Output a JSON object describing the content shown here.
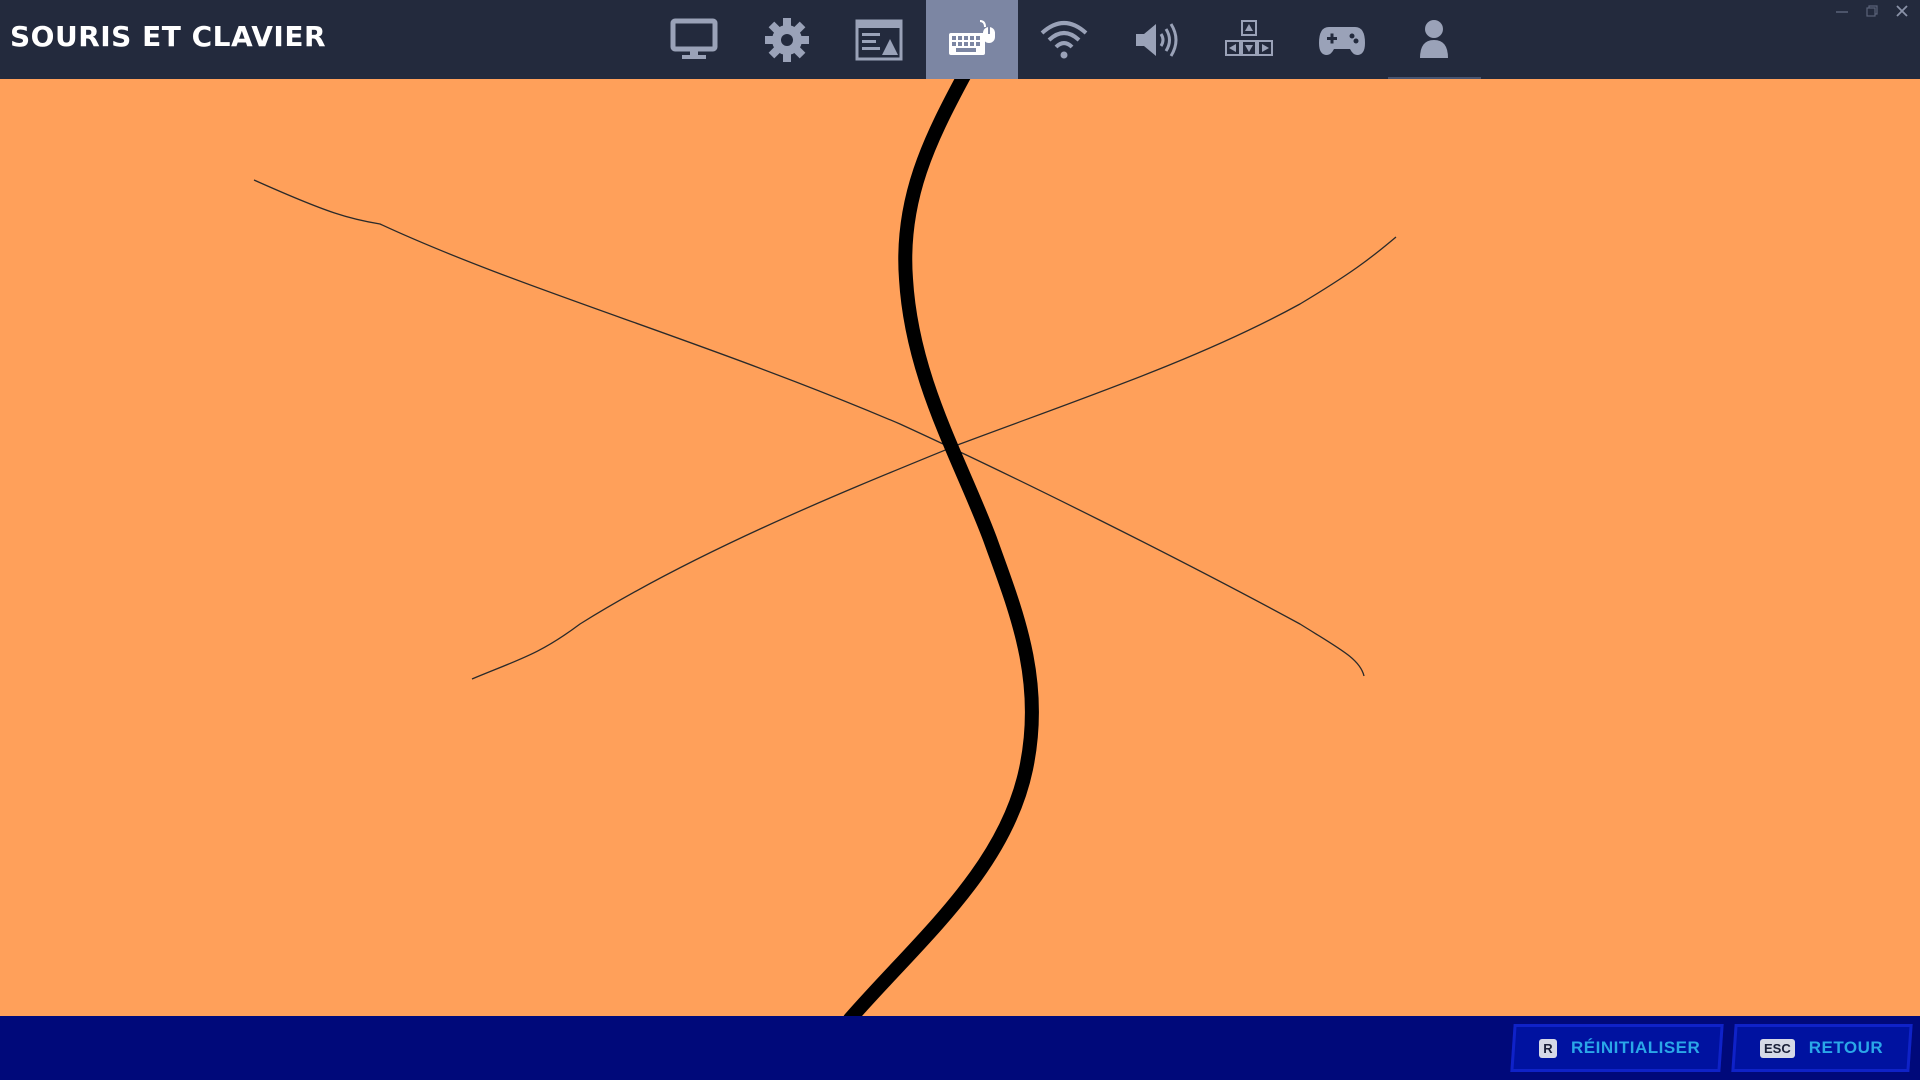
{
  "header": {
    "title": "SOURIS ET CLAVIER",
    "tabs": [
      {
        "icon": "monitor-icon",
        "active": false
      },
      {
        "icon": "gear-icon",
        "active": false
      },
      {
        "icon": "interface-icon",
        "active": false
      },
      {
        "icon": "keyboard-mouse-icon",
        "active": true
      },
      {
        "icon": "wifi-icon",
        "active": false
      },
      {
        "icon": "speaker-icon",
        "active": false
      },
      {
        "icon": "accessibility-arrows-icon",
        "active": false
      },
      {
        "icon": "gamepad-icon",
        "active": false
      },
      {
        "icon": "account-icon",
        "active": false
      }
    ]
  },
  "window_controls": [
    "minimize-icon",
    "restore-icon",
    "close-icon"
  ],
  "footer": {
    "reset": {
      "key": "R",
      "label": "RÉINITIALISER"
    },
    "back": {
      "key": "ESC",
      "label": "RETOUR"
    }
  },
  "colors": {
    "topbar": "#232a3d",
    "active_tab": "#7c86a3",
    "canvas": "#ffa05a",
    "footer": "#00097a",
    "footer_text": "#2aa7e8"
  }
}
